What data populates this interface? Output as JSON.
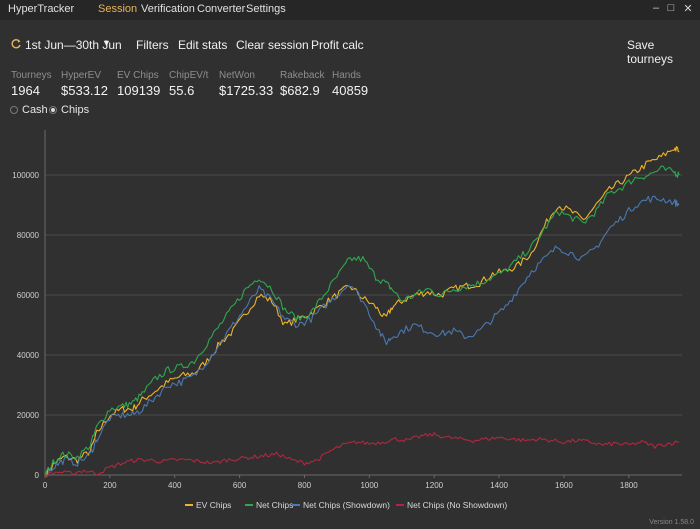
{
  "app": {
    "title": "HyperTracker",
    "version": "Version 1.58.0"
  },
  "menu": [
    {
      "label": "Session",
      "active": true
    },
    {
      "label": "Verification",
      "active": false
    },
    {
      "label": "Converter",
      "active": false
    },
    {
      "label": "Settings",
      "active": false
    }
  ],
  "window_controls": {
    "minimize": "–",
    "maximize": "□",
    "close": "✕"
  },
  "toolbar": {
    "date_range": "1st Jun—30th Jun",
    "date_icon": "refresh-icon",
    "filters": "Filters",
    "edit_stats": "Edit stats",
    "clear_session": "Clear session",
    "profit_calc": "Profit calc",
    "save_tourneys": "Save tourneys"
  },
  "stats": [
    {
      "label": "Tourneys",
      "value": "1964"
    },
    {
      "label": "HyperEV",
      "value": "$533.12"
    },
    {
      "label": "EV Chips",
      "value": "109139"
    },
    {
      "label": "ChipEV/t",
      "value": "55.6"
    },
    {
      "label": "NetWon",
      "value": "$1725.33"
    },
    {
      "label": "Rakeback",
      "value": "$682.9"
    },
    {
      "label": "Hands",
      "value": "40859"
    }
  ],
  "mode": {
    "options": [
      "Cash",
      "Chips"
    ],
    "selected": "Chips"
  },
  "chart_data": {
    "type": "line",
    "xlim": [
      0,
      1964
    ],
    "ylim": [
      0,
      115000
    ],
    "x_ticks": [
      0,
      200,
      400,
      600,
      800,
      1000,
      1200,
      1400,
      1600,
      1800
    ],
    "y_ticks": [
      0,
      20000,
      40000,
      60000,
      80000,
      100000
    ],
    "grid": "horizontal",
    "legend_position": "bottom",
    "series": [
      {
        "name": "EV Chips",
        "color": "#f0b429",
        "points": [
          [
            0,
            0
          ],
          [
            30,
            4000
          ],
          [
            60,
            6000
          ],
          [
            100,
            5000
          ],
          [
            140,
            8000
          ],
          [
            160,
            14000
          ],
          [
            200,
            20000
          ],
          [
            240,
            22000
          ],
          [
            270,
            22000
          ],
          [
            300,
            25000
          ],
          [
            340,
            28000
          ],
          [
            380,
            31000
          ],
          [
            420,
            33000
          ],
          [
            460,
            34000
          ],
          [
            500,
            38000
          ],
          [
            540,
            44000
          ],
          [
            580,
            48000
          ],
          [
            620,
            54000
          ],
          [
            660,
            60000
          ],
          [
            700,
            58000
          ],
          [
            740,
            50000
          ],
          [
            780,
            52000
          ],
          [
            820,
            54000
          ],
          [
            860,
            57000
          ],
          [
            900,
            60000
          ],
          [
            940,
            63000
          ],
          [
            980,
            59000
          ],
          [
            1020,
            56000
          ],
          [
            1050,
            52000
          ],
          [
            1070,
            56000
          ],
          [
            1100,
            58000
          ],
          [
            1140,
            60000
          ],
          [
            1180,
            61000
          ],
          [
            1220,
            60000
          ],
          [
            1260,
            62000
          ],
          [
            1300,
            63000
          ],
          [
            1340,
            64000
          ],
          [
            1380,
            67000
          ],
          [
            1420,
            68000
          ],
          [
            1460,
            70000
          ],
          [
            1500,
            74000
          ],
          [
            1540,
            83000
          ],
          [
            1580,
            90000
          ],
          [
            1620,
            88000
          ],
          [
            1660,
            85000
          ],
          [
            1700,
            90000
          ],
          [
            1740,
            95000
          ],
          [
            1780,
            98000
          ],
          [
            1820,
            101000
          ],
          [
            1860,
            104000
          ],
          [
            1900,
            106000
          ],
          [
            1940,
            109000
          ],
          [
            1955,
            108000
          ]
        ]
      },
      {
        "name": "Net Chips",
        "color": "#2fa84f",
        "points": [
          [
            0,
            0
          ],
          [
            30,
            5000
          ],
          [
            60,
            7000
          ],
          [
            100,
            6000
          ],
          [
            140,
            10000
          ],
          [
            160,
            16000
          ],
          [
            200,
            22000
          ],
          [
            240,
            23000
          ],
          [
            270,
            24000
          ],
          [
            300,
            27000
          ],
          [
            340,
            32000
          ],
          [
            380,
            35000
          ],
          [
            420,
            36000
          ],
          [
            460,
            38000
          ],
          [
            500,
            44000
          ],
          [
            540,
            50000
          ],
          [
            580,
            56000
          ],
          [
            620,
            62000
          ],
          [
            660,
            66000
          ],
          [
            700,
            62000
          ],
          [
            740,
            55000
          ],
          [
            780,
            52000
          ],
          [
            820,
            54000
          ],
          [
            860,
            60000
          ],
          [
            900,
            66000
          ],
          [
            940,
            72000
          ],
          [
            980,
            72000
          ],
          [
            1020,
            66000
          ],
          [
            1050,
            64000
          ],
          [
            1070,
            62000
          ],
          [
            1100,
            58000
          ],
          [
            1140,
            60000
          ],
          [
            1180,
            62000
          ],
          [
            1220,
            60000
          ],
          [
            1260,
            62000
          ],
          [
            1300,
            63000
          ],
          [
            1340,
            64000
          ],
          [
            1380,
            66000
          ],
          [
            1420,
            68000
          ],
          [
            1460,
            72000
          ],
          [
            1500,
            76000
          ],
          [
            1540,
            82000
          ],
          [
            1580,
            88000
          ],
          [
            1620,
            86000
          ],
          [
            1660,
            84000
          ],
          [
            1700,
            88000
          ],
          [
            1740,
            94000
          ],
          [
            1780,
            96000
          ],
          [
            1820,
            99000
          ],
          [
            1860,
            100000
          ],
          [
            1900,
            102000
          ],
          [
            1940,
            101000
          ],
          [
            1955,
            100000
          ]
        ]
      },
      {
        "name": "Net Chips (Showdown)",
        "color": "#4a78b0",
        "points": [
          [
            0,
            0
          ],
          [
            30,
            3000
          ],
          [
            60,
            5000
          ],
          [
            100,
            4000
          ],
          [
            140,
            7000
          ],
          [
            160,
            12000
          ],
          [
            200,
            19000
          ],
          [
            240,
            20000
          ],
          [
            270,
            20000
          ],
          [
            300,
            22000
          ],
          [
            340,
            26000
          ],
          [
            380,
            30000
          ],
          [
            420,
            31000
          ],
          [
            460,
            33000
          ],
          [
            500,
            38000
          ],
          [
            540,
            44000
          ],
          [
            580,
            50000
          ],
          [
            620,
            56000
          ],
          [
            660,
            62000
          ],
          [
            700,
            58000
          ],
          [
            740,
            52000
          ],
          [
            780,
            50000
          ],
          [
            820,
            52000
          ],
          [
            860,
            56000
          ],
          [
            900,
            60000
          ],
          [
            940,
            64000
          ],
          [
            980,
            58000
          ],
          [
            1020,
            50000
          ],
          [
            1050,
            44000
          ],
          [
            1070,
            46000
          ],
          [
            1100,
            48000
          ],
          [
            1140,
            50000
          ],
          [
            1180,
            48000
          ],
          [
            1220,
            47000
          ],
          [
            1260,
            48000
          ],
          [
            1300,
            46000
          ],
          [
            1340,
            48000
          ],
          [
            1380,
            52000
          ],
          [
            1420,
            56000
          ],
          [
            1460,
            62000
          ],
          [
            1500,
            68000
          ],
          [
            1540,
            72000
          ],
          [
            1580,
            76000
          ],
          [
            1620,
            74000
          ],
          [
            1660,
            72000
          ],
          [
            1700,
            76000
          ],
          [
            1740,
            82000
          ],
          [
            1780,
            86000
          ],
          [
            1820,
            90000
          ],
          [
            1860,
            92000
          ],
          [
            1900,
            92000
          ],
          [
            1940,
            91000
          ],
          [
            1955,
            90000
          ]
        ]
      },
      {
        "name": "Net Chips (No Showdown)",
        "color": "#b0283e",
        "points": [
          [
            0,
            0
          ],
          [
            40,
            1000
          ],
          [
            80,
            500
          ],
          [
            120,
            1500
          ],
          [
            160,
            500
          ],
          [
            200,
            2500
          ],
          [
            240,
            4000
          ],
          [
            280,
            5000
          ],
          [
            320,
            5000
          ],
          [
            360,
            4500
          ],
          [
            400,
            5000
          ],
          [
            440,
            5000
          ],
          [
            480,
            4500
          ],
          [
            520,
            4000
          ],
          [
            560,
            5000
          ],
          [
            600,
            5500
          ],
          [
            640,
            6000
          ],
          [
            680,
            6500
          ],
          [
            720,
            7000
          ],
          [
            760,
            5000
          ],
          [
            800,
            4000
          ],
          [
            840,
            5000
          ],
          [
            880,
            8000
          ],
          [
            920,
            10000
          ],
          [
            960,
            11000
          ],
          [
            1000,
            10500
          ],
          [
            1040,
            11000
          ],
          [
            1080,
            12000
          ],
          [
            1120,
            11500
          ],
          [
            1160,
            13000
          ],
          [
            1200,
            13500
          ],
          [
            1240,
            12500
          ],
          [
            1280,
            12000
          ],
          [
            1320,
            11500
          ],
          [
            1360,
            12000
          ],
          [
            1400,
            12500
          ],
          [
            1440,
            12000
          ],
          [
            1480,
            11500
          ],
          [
            1520,
            12000
          ],
          [
            1560,
            11500
          ],
          [
            1600,
            11000
          ],
          [
            1640,
            11500
          ],
          [
            1680,
            11000
          ],
          [
            1720,
            10000
          ],
          [
            1760,
            10500
          ],
          [
            1800,
            10000
          ],
          [
            1840,
            11000
          ],
          [
            1880,
            9500
          ],
          [
            1920,
            10500
          ],
          [
            1955,
            11000
          ]
        ]
      }
    ]
  }
}
